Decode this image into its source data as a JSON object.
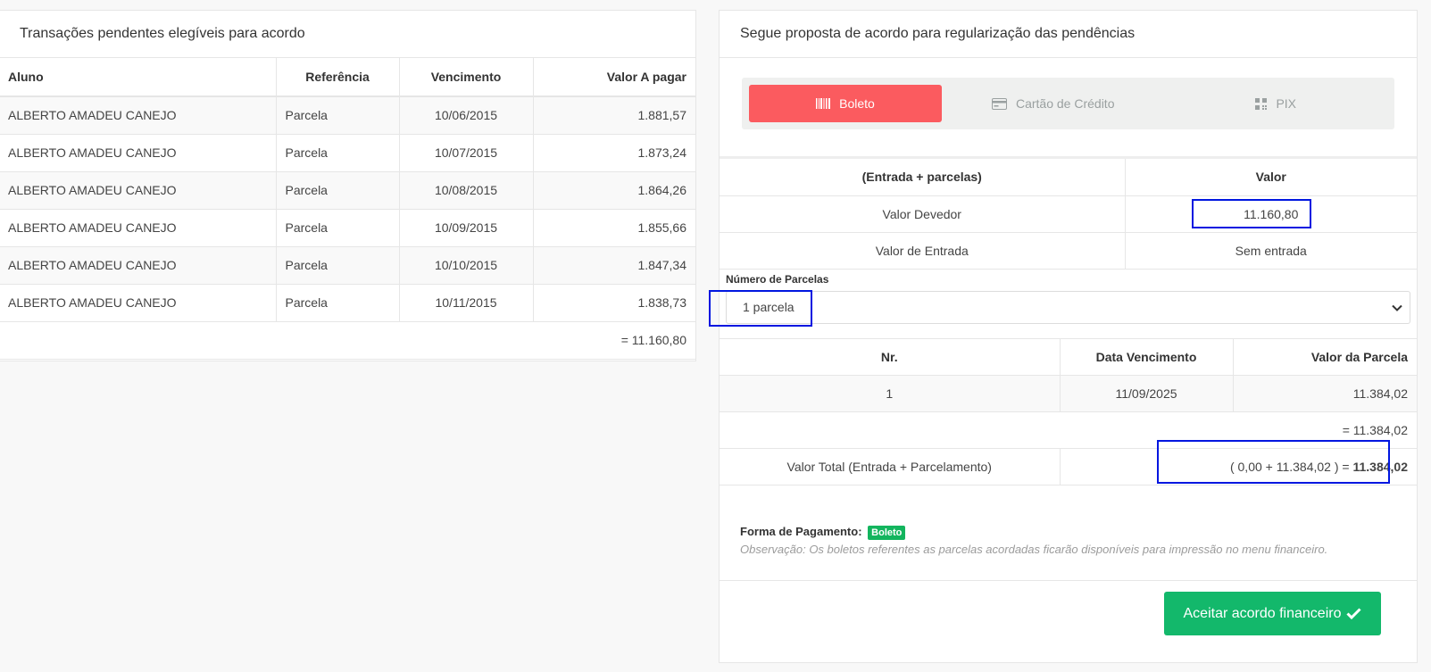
{
  "left": {
    "title": "Transações pendentes elegíveis para acordo",
    "columns": [
      "Aluno",
      "Referência",
      "Vencimento",
      "Valor A pagar"
    ],
    "rows": [
      {
        "aluno": "ALBERTO AMADEU CANEJO",
        "ref": "Parcela",
        "venc": "10/06/2015",
        "valor": "1.881,57"
      },
      {
        "aluno": "ALBERTO AMADEU CANEJO",
        "ref": "Parcela",
        "venc": "10/07/2015",
        "valor": "1.873,24"
      },
      {
        "aluno": "ALBERTO AMADEU CANEJO",
        "ref": "Parcela",
        "venc": "10/08/2015",
        "valor": "1.864,26"
      },
      {
        "aluno": "ALBERTO AMADEU CANEJO",
        "ref": "Parcela",
        "venc": "10/09/2015",
        "valor": "1.855,66"
      },
      {
        "aluno": "ALBERTO AMADEU CANEJO",
        "ref": "Parcela",
        "venc": "10/10/2015",
        "valor": "1.847,34"
      },
      {
        "aluno": "ALBERTO AMADEU CANEJO",
        "ref": "Parcela",
        "venc": "10/11/2015",
        "valor": "1.838,73"
      }
    ],
    "total": "= 11.160,80"
  },
  "right": {
    "title": "Segue proposta de acordo para regularização das pendências",
    "tabs": [
      {
        "label": "Boleto",
        "icon": "barcode-icon",
        "active": true
      },
      {
        "label": "Cartão de Crédito",
        "icon": "credit-card-icon",
        "active": false
      },
      {
        "label": "PIX",
        "icon": "qrcode-icon",
        "active": false
      }
    ],
    "summary_header": [
      "(Entrada + parcelas)",
      "Valor"
    ],
    "valor_devedor_label": "Valor Devedor",
    "valor_devedor": "11.160,80",
    "valor_entrada_label": "Valor de Entrada",
    "valor_entrada": "Sem entrada",
    "parcelas_label": "Número de Parcelas",
    "parcelas_selected": "1 parcela",
    "installments_header": [
      "Nr.",
      "Data Vencimento",
      "Valor da Parcela"
    ],
    "installments": [
      {
        "nr": "1",
        "data": "11/09/2025",
        "valor": "11.384,02"
      }
    ],
    "installments_total": "= 11.384,02",
    "valor_total_label": "Valor Total (Entrada + Parcelamento)",
    "valor_total_expr": "( 0,00 + 11.384,02 ) = ",
    "valor_total": "11.384,02",
    "forma_pagamento_label": "Forma de Pagamento:",
    "forma_pagamento": "Boleto",
    "observacao": "Observação: Os boletos referentes as parcelas acordadas ficarão disponíveis para impressão no menu financeiro.",
    "accept_label": "Aceitar acordo financeiro"
  },
  "colors": {
    "active_tab": "#fb5b5f",
    "accept": "#13b86b",
    "badge": "#13b55e",
    "highlight": "#0016e0"
  }
}
